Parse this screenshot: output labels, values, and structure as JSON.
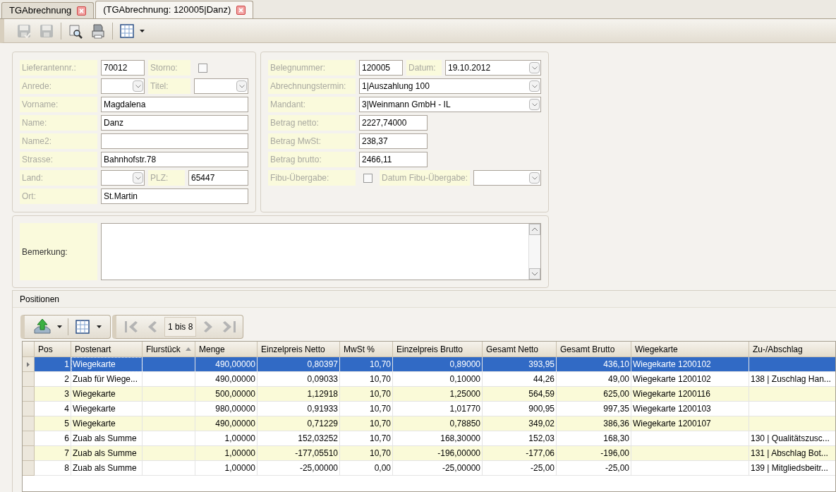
{
  "tabs": [
    {
      "label": "TGAbrechnung",
      "selected": false
    },
    {
      "label": "(TGAbrechnung: 120005|Danz)",
      "selected": true
    }
  ],
  "toolbar": [
    {
      "kind": "save-check",
      "disabled": true
    },
    {
      "kind": "save",
      "disabled": true
    },
    {
      "kind": "sep"
    },
    {
      "kind": "preview",
      "disabled": false
    },
    {
      "kind": "print",
      "disabled": false
    },
    {
      "kind": "sep"
    },
    {
      "kind": "grid",
      "disabled": false
    }
  ],
  "left_form": [
    [
      {
        "label": "Lieferantennr.:",
        "kind": "text",
        "value": "70012"
      },
      {
        "label": "Storno:",
        "kind": "checkbox",
        "checked": false
      }
    ],
    [
      {
        "label": "Anrede:",
        "kind": "select"
      },
      {
        "label": "Titel:",
        "kind": "select"
      }
    ],
    [
      {
        "label": "Vorname:",
        "kind": "text",
        "value": "Magdalena"
      }
    ],
    [
      {
        "label": "Name:",
        "kind": "text",
        "value": "Danz"
      }
    ],
    [
      {
        "label": "Name2:",
        "kind": "text"
      }
    ],
    [
      {
        "label": "Strasse:",
        "kind": "text",
        "value": "Bahnhofstr.78"
      }
    ],
    [
      {
        "label": "Land:",
        "kind": "select"
      },
      {
        "label": "PLZ:",
        "kind": "text",
        "value": "65447"
      }
    ],
    [
      {
        "label": "Ort:",
        "kind": "text",
        "value": "St.Martin"
      }
    ]
  ],
  "right_form": [
    [
      {
        "label": "Belegnummer:",
        "kind": "text",
        "value": "120005"
      },
      {
        "label": "Datum:",
        "kind": "select",
        "value": "19.10.2012"
      }
    ],
    [
      {
        "label": "Abrechnungstermin:",
        "kind": "select",
        "value": "1|Auszahlung 100"
      }
    ],
    [
      {
        "label": "Mandant:",
        "kind": "select",
        "value": "3|Weinmann GmbH - IL"
      }
    ],
    [
      {
        "label": "Betrag netto:",
        "kind": "short",
        "value": "2227,74000"
      }
    ],
    [
      {
        "label": "Betrag MwSt:",
        "kind": "short",
        "value": "238,37"
      }
    ],
    [
      {
        "label": "Betrag brutto:",
        "kind": "short",
        "value": "2466,11"
      }
    ],
    [
      {
        "label": "Fibu-Übergabe:",
        "kind": "checkbox",
        "checked": false
      },
      {
        "label": "Datum Fibu-Übergabe:",
        "kind": "select"
      }
    ]
  ],
  "remark": {
    "label": "Bemerkung:"
  },
  "positions": {
    "title": "Positionen",
    "pager": "1 bis 8",
    "columns": [
      {
        "label": "Pos",
        "sorted": false
      },
      {
        "label": "Postenart",
        "sorted": false
      },
      {
        "label": "Flurstück",
        "sorted": true
      },
      {
        "label": "Menge",
        "sorted": false
      },
      {
        "label": "Einzelpreis Netto",
        "sorted": false
      },
      {
        "label": "MwSt %",
        "sorted": false
      },
      {
        "label": "Einzelpreis Brutto",
        "sorted": false
      },
      {
        "label": "Gesamt Netto",
        "sorted": false
      },
      {
        "label": "Gesamt Brutto",
        "sorted": false
      },
      {
        "label": "Wiegekarte",
        "sorted": false
      },
      {
        "label": "Zu-/Abschlag",
        "sorted": false
      }
    ],
    "rows": [
      {
        "selected": true,
        "cells": [
          "1",
          "Wiegekarte",
          "",
          "490,00000",
          "0,80397",
          "10,70",
          "0,89000",
          "393,95",
          "436,10",
          "Wiegekarte 1200102",
          ""
        ]
      },
      {
        "selected": false,
        "cells": [
          "2",
          "Zuab für Wiege...",
          "",
          "490,00000",
          "0,09033",
          "10,70",
          "0,10000",
          "44,26",
          "49,00",
          "Wiegekarte 1200102",
          "138 | Zuschlag Han..."
        ]
      },
      {
        "selected": false,
        "cells": [
          "3",
          "Wiegekarte",
          "",
          "500,00000",
          "1,12918",
          "10,70",
          "1,25000",
          "564,59",
          "625,00",
          "Wiegekarte 1200116",
          ""
        ]
      },
      {
        "selected": false,
        "cells": [
          "4",
          "Wiegekarte",
          "",
          "980,00000",
          "0,91933",
          "10,70",
          "1,01770",
          "900,95",
          "997,35",
          "Wiegekarte 1200103",
          ""
        ]
      },
      {
        "selected": false,
        "cells": [
          "5",
          "Wiegekarte",
          "",
          "490,00000",
          "0,71229",
          "10,70",
          "0,78850",
          "349,02",
          "386,36",
          "Wiegekarte 1200107",
          ""
        ]
      },
      {
        "selected": false,
        "cells": [
          "6",
          "Zuab als Summe",
          "",
          "1,00000",
          "152,03252",
          "10,70",
          "168,30000",
          "152,03",
          "168,30",
          "",
          "130 | Qualitätszusc..."
        ]
      },
      {
        "selected": false,
        "cells": [
          "7",
          "Zuab als Summe",
          "",
          "1,00000",
          "-177,05510",
          "10,70",
          "-196,00000",
          "-177,06",
          "-196,00",
          "",
          "131 | Abschlag Bot..."
        ]
      },
      {
        "selected": false,
        "cells": [
          "8",
          "Zuab als Summe",
          "",
          "1,00000",
          "-25,00000",
          "0,00",
          "-25,00000",
          "-25,00",
          "-25,00",
          "",
          "139 | Mitgliedsbeitr..."
        ]
      }
    ]
  }
}
